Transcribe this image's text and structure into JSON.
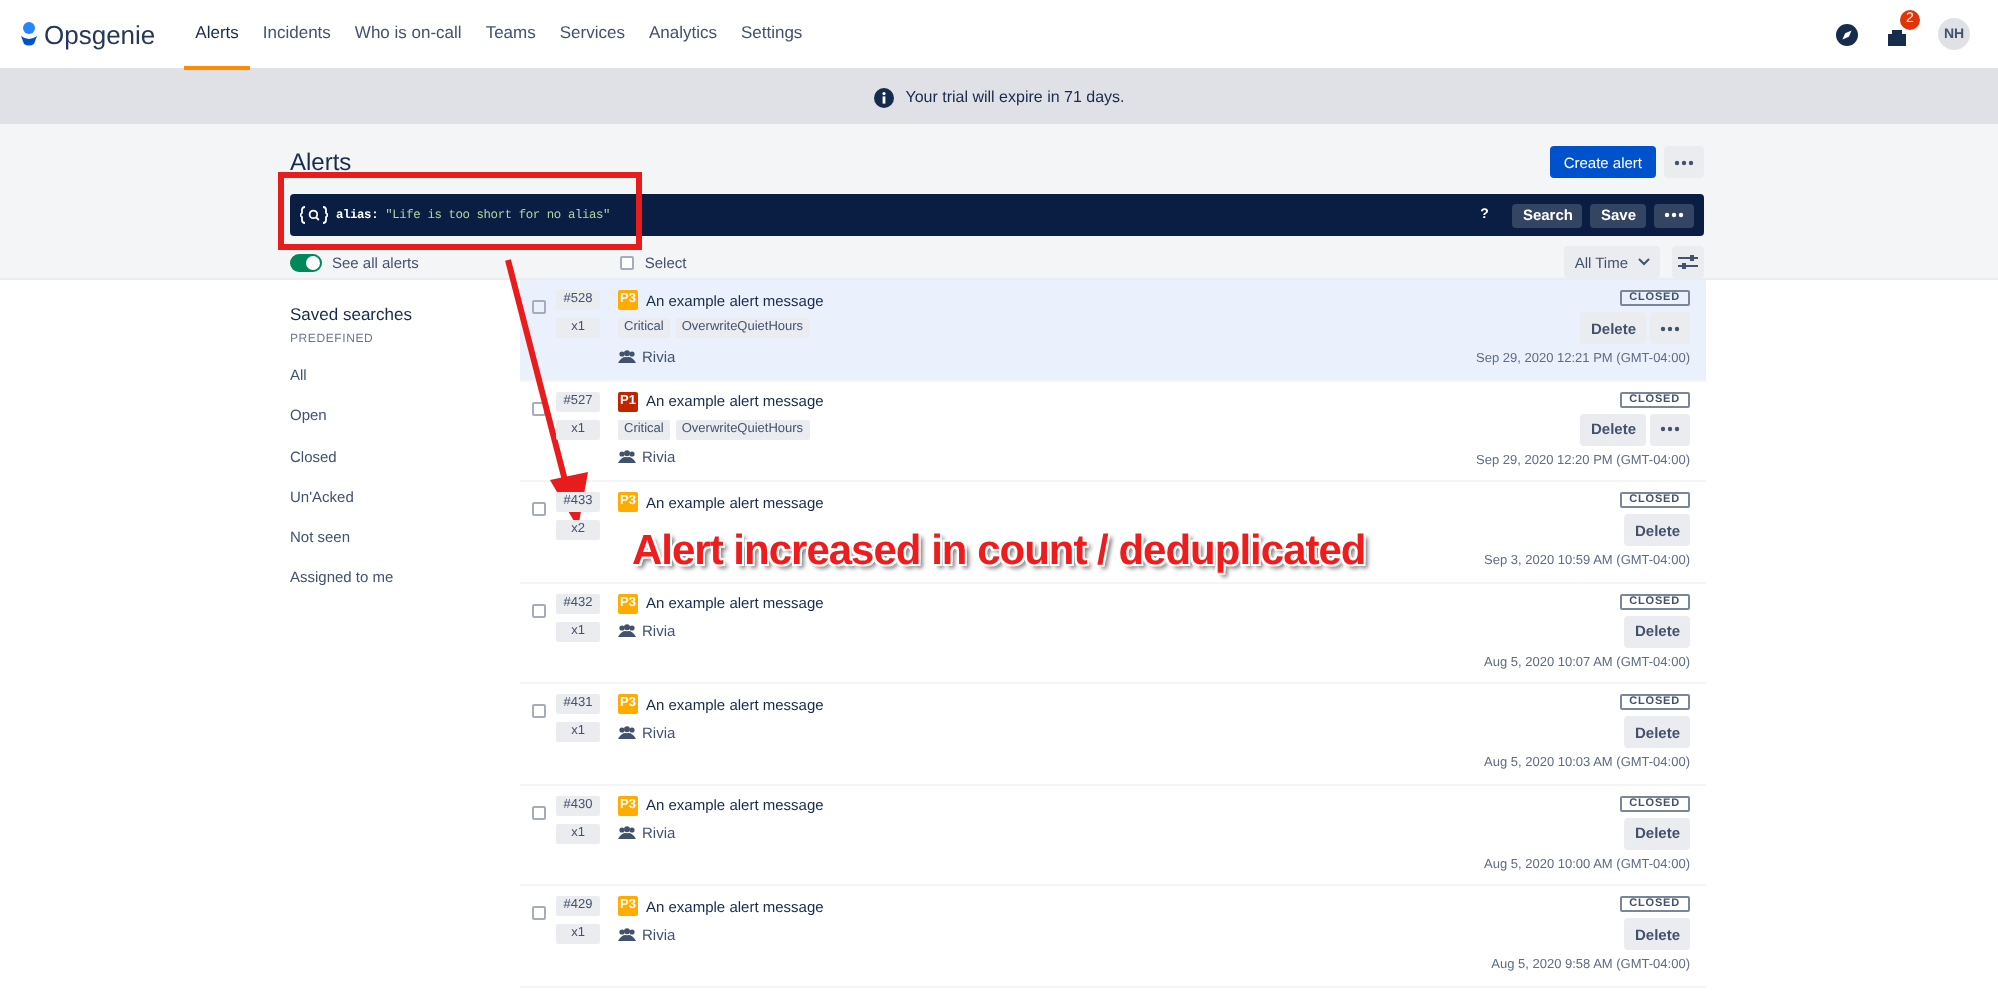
{
  "nav": {
    "logo": "Opsgenie",
    "items": [
      {
        "label": "Alerts",
        "selected": true
      },
      {
        "label": "Incidents",
        "selected": false
      },
      {
        "label": "Who is on-call",
        "selected": false
      },
      {
        "label": "Teams",
        "selected": false
      },
      {
        "label": "Services",
        "selected": false
      },
      {
        "label": "Analytics",
        "selected": false
      },
      {
        "label": "Settings",
        "selected": false
      }
    ],
    "notification_count": "2",
    "avatar": "NH"
  },
  "banner": {
    "text": "Your trial will expire in 71 days."
  },
  "page": {
    "title": "Alerts",
    "create_button": "Create alert"
  },
  "search": {
    "key": "alias:",
    "value": "\"Life is too short for no alias\"",
    "help": "?",
    "buttons": [
      "Search",
      "Save"
    ]
  },
  "controls": {
    "toggle": {
      "label": "See all alerts",
      "on": true
    },
    "select": {
      "label": "Select",
      "checked": false
    },
    "time_filter": "All Time"
  },
  "sidebar": {
    "title": "Saved searches",
    "section": "PREDEFINED",
    "items": [
      "All",
      "Open",
      "Closed",
      "Un'Acked",
      "Not seen",
      "Assigned to me"
    ]
  },
  "alerts": [
    {
      "id": "#528",
      "count": "x1",
      "priority": "P3",
      "color": "#ffab00",
      "message": "An example alert message",
      "tags": [
        "Critical",
        "OverwriteQuietHours"
      ],
      "owner": "Rivia",
      "status": "CLOSED",
      "delete": "Delete",
      "more": true,
      "time": "Sep 29, 2020 12:21 PM (GMT-04:00)",
      "highlighted": true
    },
    {
      "id": "#527",
      "count": "x1",
      "priority": "P1",
      "color": "#bf2600",
      "message": "An example alert message",
      "tags": [
        "Critical",
        "OverwriteQuietHours"
      ],
      "owner": "Rivia",
      "status": "CLOSED",
      "delete": "Delete",
      "more": true,
      "time": "Sep 29, 2020 12:20 PM (GMT-04:00)",
      "highlighted": false
    },
    {
      "id": "#433",
      "count": "x2",
      "priority": "P3",
      "color": "#ffab00",
      "message": "An example alert message",
      "status": "CLOSED",
      "delete": "Delete",
      "more": false,
      "time": "Sep 3, 2020 10:59 AM (GMT-04:00)",
      "highlighted": false
    },
    {
      "id": "#432",
      "count": "x1",
      "priority": "P3",
      "color": "#ffab00",
      "message": "An example alert message",
      "owner": "Rivia",
      "status": "CLOSED",
      "delete": "Delete",
      "more": false,
      "time": "Aug 5, 2020 10:07 AM (GMT-04:00)",
      "highlighted": false
    },
    {
      "id": "#431",
      "count": "x1",
      "priority": "P3",
      "color": "#ffab00",
      "message": "An example alert message",
      "owner": "Rivia",
      "status": "CLOSED",
      "delete": "Delete",
      "more": false,
      "time": "Aug 5, 2020 10:03 AM (GMT-04:00)",
      "highlighted": false
    },
    {
      "id": "#430",
      "count": "x1",
      "priority": "P3",
      "color": "#ffab00",
      "message": "An example alert message",
      "owner": "Rivia",
      "status": "CLOSED",
      "delete": "Delete",
      "more": false,
      "time": "Aug 5, 2020 10:00 AM (GMT-04:00)",
      "highlighted": false
    },
    {
      "id": "#429",
      "count": "x1",
      "priority": "P3",
      "color": "#ffab00",
      "message": "An example alert message",
      "owner": "Rivia",
      "status": "CLOSED",
      "delete": "Delete",
      "more": false,
      "time": "Aug 5, 2020 9:58 AM (GMT-04:00)",
      "highlighted": false
    }
  ],
  "annotation": {
    "text": "Alert increased in count / deduplicated"
  }
}
